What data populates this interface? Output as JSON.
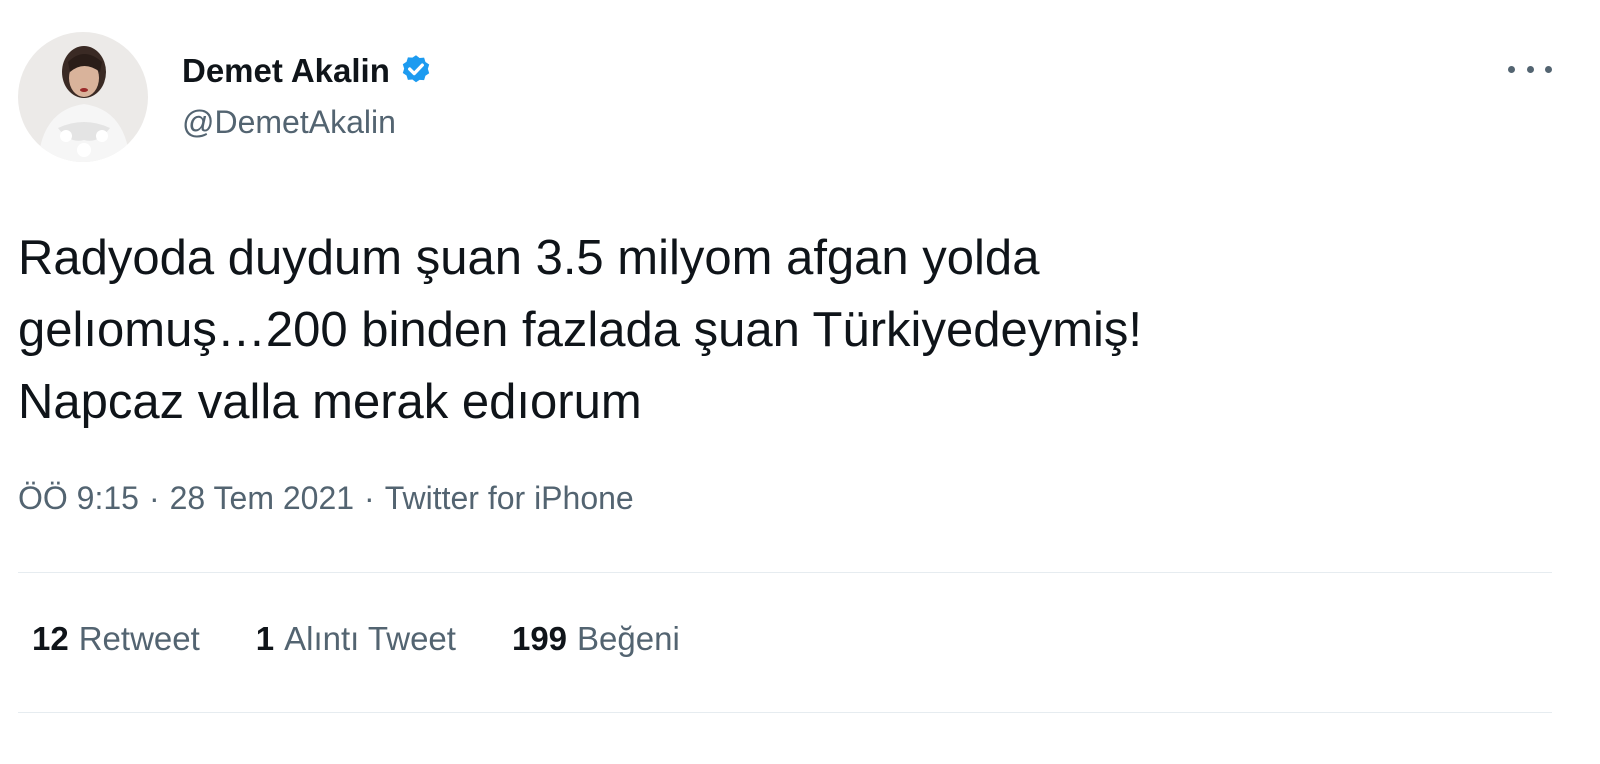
{
  "author": {
    "display_name": "Demet Akalin",
    "handle": "@DemetAkalin",
    "verified": true,
    "verified_color": "#1d9bf0",
    "avatar_icon": "profile-photo"
  },
  "tweet": {
    "text": "Radyoda duydum şuan 3.5 milyom afgan yolda\ngelıomuş…200 binden fazlada şuan Türkiyedeymiş!\nNapcaz valla merak edıorum"
  },
  "meta": {
    "time": "ÖÖ 9:15",
    "separator": "·",
    "date": "28 Tem 2021",
    "source": "Twitter for iPhone"
  },
  "stats": [
    {
      "count": "12",
      "label": "Retweet"
    },
    {
      "count": "1",
      "label": "Alıntı Tweet"
    },
    {
      "count": "199",
      "label": "Beğeni"
    }
  ],
  "colors": {
    "text_primary": "#0f1419",
    "text_secondary": "#536471",
    "divider": "#e6ecf0"
  },
  "icons": {
    "more": "more-horizontal-icon",
    "verified": "verified-badge-icon"
  }
}
